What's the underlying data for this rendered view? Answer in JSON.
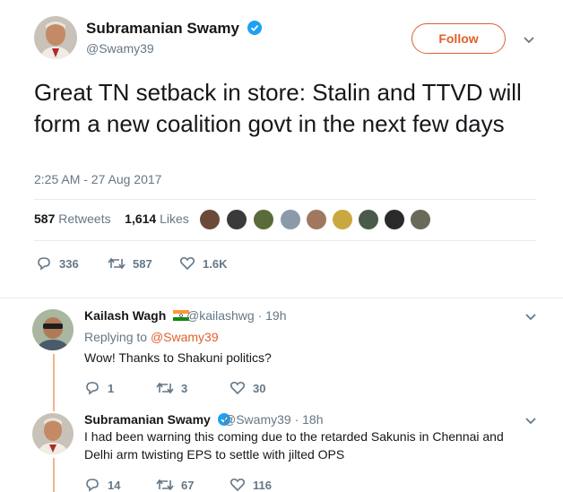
{
  "main_tweet": {
    "author_name": "Subramanian Swamy",
    "author_handle": "@Swamy39",
    "follow_label": "Follow",
    "text": "Great TN setback in store: Stalin and TTVD will form a new coalition govt in the next few days",
    "timestamp": "2:25 AM - 27 Aug 2017",
    "retweets_count": "587",
    "retweets_label": "Retweets",
    "likes_count": "1,614",
    "likes_label": "Likes",
    "actions": {
      "replies": "336",
      "retweets": "587",
      "likes": "1.6K"
    }
  },
  "replies": [
    {
      "author_name": "Kailash Wagh",
      "author_handle": "@kailashwg",
      "time": "· 19h",
      "replying_prefix": "Replying to",
      "replying_to": "@Swamy39",
      "text": "Wow! Thanks to Shakuni politics?",
      "actions": {
        "replies": "1",
        "retweets": "3",
        "likes": "30"
      }
    },
    {
      "author_name": "Subramanian Swamy",
      "author_handle": "@Swamy39",
      "time": "· 18h",
      "text": "I had been warning this coming due to  the retarded Sakunis in Chennai and Delhi arm twisting EPS to settle with jilted OPS",
      "actions": {
        "replies": "14",
        "retweets": "67",
        "likes": "116"
      }
    }
  ],
  "colors": {
    "accent": "#e0602a",
    "verified": "#1da1f2",
    "muted": "#657786",
    "text": "#14171a",
    "thread": "#f6b48c"
  }
}
